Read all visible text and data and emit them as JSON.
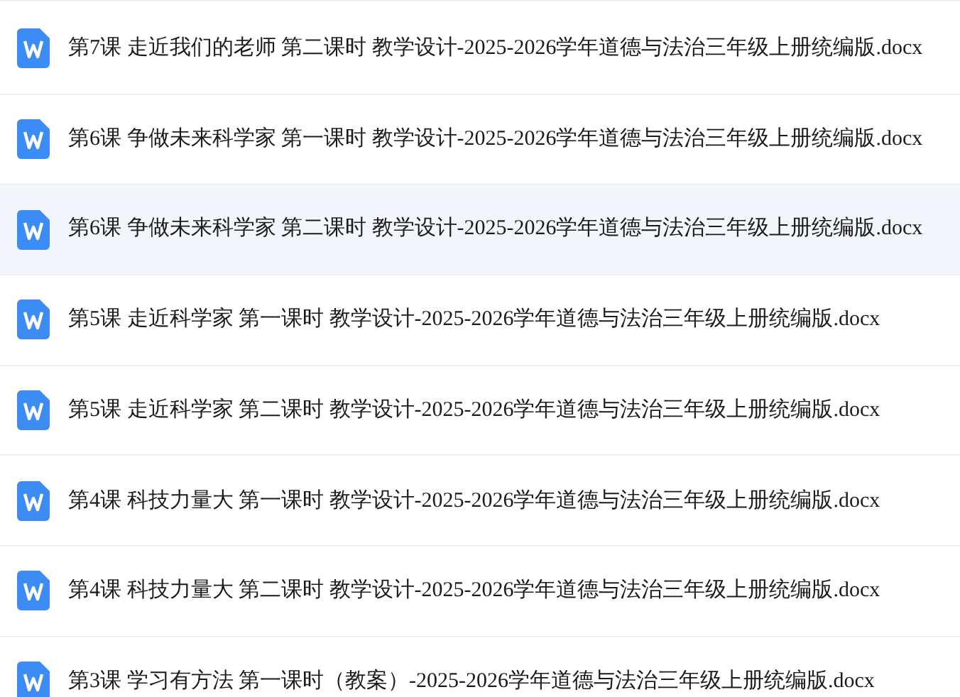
{
  "files": [
    {
      "name": "第7课 走近我们的老师 第二课时 教学设计-2025-2026学年道德与法治三年级上册统编版.docx",
      "selected": false
    },
    {
      "name": "第6课 争做未来科学家 第一课时 教学设计-2025-2026学年道德与法治三年级上册统编版.docx",
      "selected": false
    },
    {
      "name": "第6课 争做未来科学家 第二课时 教学设计-2025-2026学年道德与法治三年级上册统编版.docx",
      "selected": true
    },
    {
      "name": "第5课 走近科学家 第一课时 教学设计-2025-2026学年道德与法治三年级上册统编版.docx",
      "selected": false
    },
    {
      "name": "第5课 走近科学家 第二课时 教学设计-2025-2026学年道德与法治三年级上册统编版.docx",
      "selected": false
    },
    {
      "name": "第4课 科技力量大 第一课时 教学设计-2025-2026学年道德与法治三年级上册统编版.docx",
      "selected": false
    },
    {
      "name": "第4课 科技力量大 第二课时 教学设计-2025-2026学年道德与法治三年级上册统编版.docx",
      "selected": false
    },
    {
      "name": "第3课 学习有方法 第一课时（教案）-2025-2026学年道德与法治三年级上册统编版.docx",
      "selected": false
    }
  ]
}
